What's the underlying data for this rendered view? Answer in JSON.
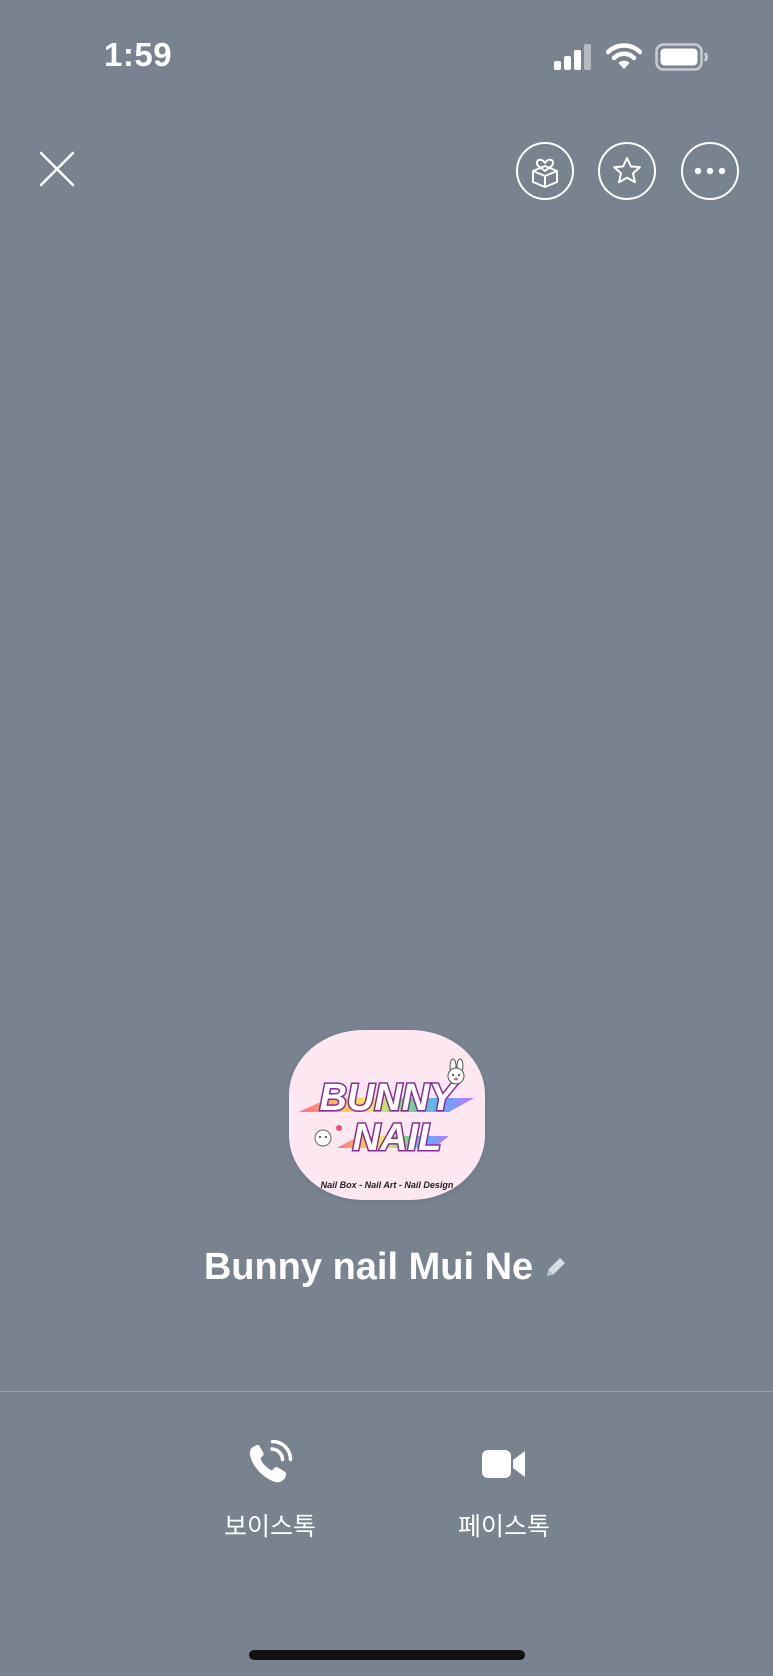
{
  "status_bar": {
    "time": "1:59",
    "icons": [
      "cellular-signal-icon",
      "wifi-icon",
      "battery-icon"
    ]
  },
  "top_bar": {
    "icons": [
      "close-icon",
      "gift-box-icon",
      "star-icon",
      "more-icon"
    ]
  },
  "profile": {
    "name": "Bunny nail Mui Ne",
    "avatar": {
      "line1": "BUNNY",
      "line2": "NAIL",
      "tagline": "Nail Box - Nail Art - Nail Design"
    }
  },
  "actions": {
    "voice_talk": {
      "label": "보이스톡",
      "icon": "phone-icon"
    },
    "face_talk": {
      "label": "페이스톡",
      "icon": "video-camera-icon"
    }
  },
  "colors": {
    "background": "#78838f",
    "foreground": "#ffffff",
    "avatar_bg": "#fde8f1"
  }
}
